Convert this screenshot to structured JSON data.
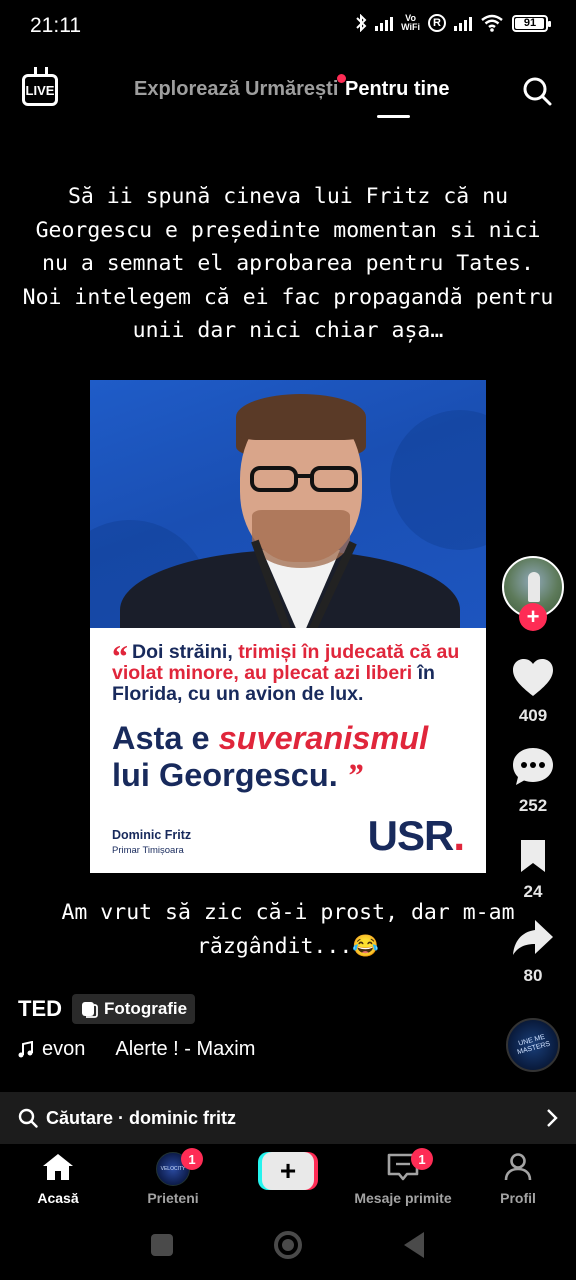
{
  "status_bar": {
    "time": "21:11",
    "vowifi_line1": "Vo",
    "vowifi_line2": "WiFi",
    "r_label": "R",
    "battery": "91"
  },
  "top_nav": {
    "live_label": "LIVE",
    "tabs": [
      {
        "label": "Explorează",
        "active": false
      },
      {
        "label": "Urmărești",
        "active": false,
        "has_dot": true
      },
      {
        "label": "Pentru tine",
        "active": true
      }
    ],
    "search_icon": "search-icon"
  },
  "post": {
    "caption_top": "Să ii spună cineva lui Fritz că nu Georgescu e președinte momentan si nici nu a semnat el aprobarea pentru Tates. Noi intelegem că ei fac propagandă pentru unii dar nici chiar așa…",
    "image": {
      "quote_open": "“",
      "quote_part1": "Doi străini, ",
      "quote_part2_red": "trimiși în judecată că au violat minore, au plecat azi liberi",
      "quote_part3": " în Florida, cu un avion de lux.",
      "slogan_part1": "Asta e ",
      "slogan_red": "suveranismul",
      "slogan_part2": "lui Georgescu.",
      "quote_close": "”",
      "signature_name": "Dominic Fritz",
      "signature_role": "Primar Timișoara",
      "logo_text": "USR",
      "logo_dot": "."
    },
    "caption_bottom": "Am vrut să zic că-i prost, dar m-am răzgândit...😂",
    "author": "TED",
    "photo_tag": "Fotografie",
    "sound_user": "evon",
    "sound_title": "Alerte ! - Maxim",
    "disc_text": "UNE ME\nMASTERS"
  },
  "actions": {
    "likes": "409",
    "comments": "252",
    "saves": "24",
    "shares": "80",
    "follow_label": "+"
  },
  "search_suggestion": {
    "text": "Căutare · dominic fritz"
  },
  "bottom_nav": {
    "items": [
      {
        "label": "Acasă",
        "active": true
      },
      {
        "label": "Prieteni",
        "badge": "1"
      },
      {
        "label": "",
        "create": "+"
      },
      {
        "label": "Mesaje primite",
        "badge": "1"
      },
      {
        "label": "Profil"
      }
    ]
  },
  "colors": {
    "accent_red": "#fe2c55",
    "accent_cyan": "#25f4ee",
    "usr_navy": "#182a5c",
    "usr_red": "#e0263b"
  }
}
